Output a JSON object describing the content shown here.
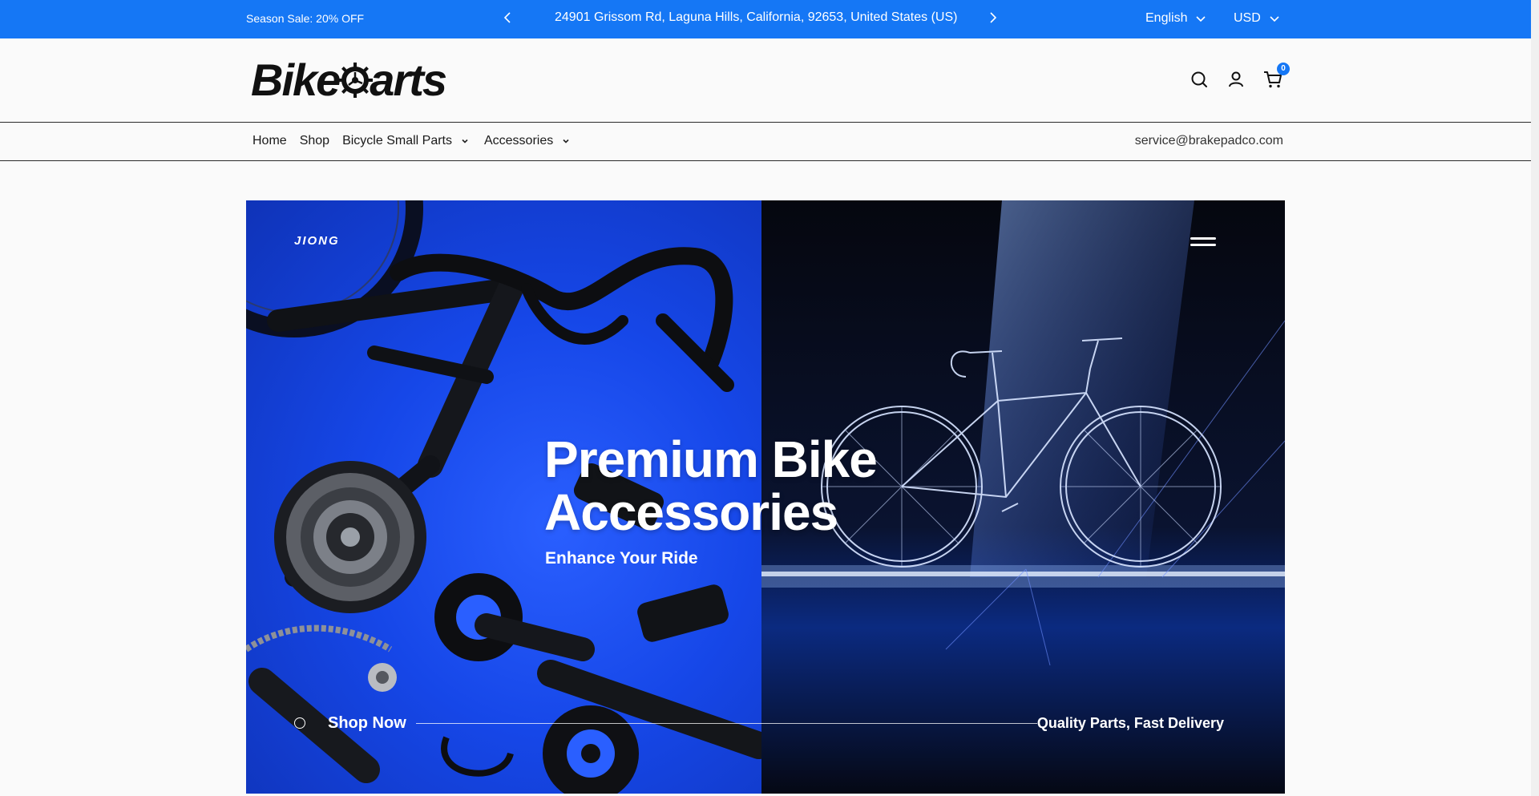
{
  "announcement": {
    "sale_text": "Season Sale: 20% OFF",
    "address": "24901 Grissom Rd, Laguna Hills, California, 92653, United States (US)",
    "language": "English",
    "currency": "USD",
    "background_color": "#1577f5"
  },
  "header": {
    "logo_text_left": "Bike",
    "logo_text_right": "arts",
    "cart_count": "0"
  },
  "nav": {
    "items": [
      {
        "label": "Home",
        "has_dropdown": false
      },
      {
        "label": "Shop",
        "has_dropdown": false
      },
      {
        "label": "Bicycle Small Parts",
        "has_dropdown": true
      },
      {
        "label": "Accessories",
        "has_dropdown": true
      }
    ],
    "email": "service@brakepadco.com"
  },
  "hero": {
    "brand": "JIONG",
    "title_line1": "Premium Bike",
    "title_line2": "Accessories",
    "subtitle": "Enhance Your Ride",
    "cta": "Shop Now",
    "tagline": "Quality Parts, Fast Delivery",
    "left_color": "#1647e8",
    "right_color": "#05070f"
  }
}
